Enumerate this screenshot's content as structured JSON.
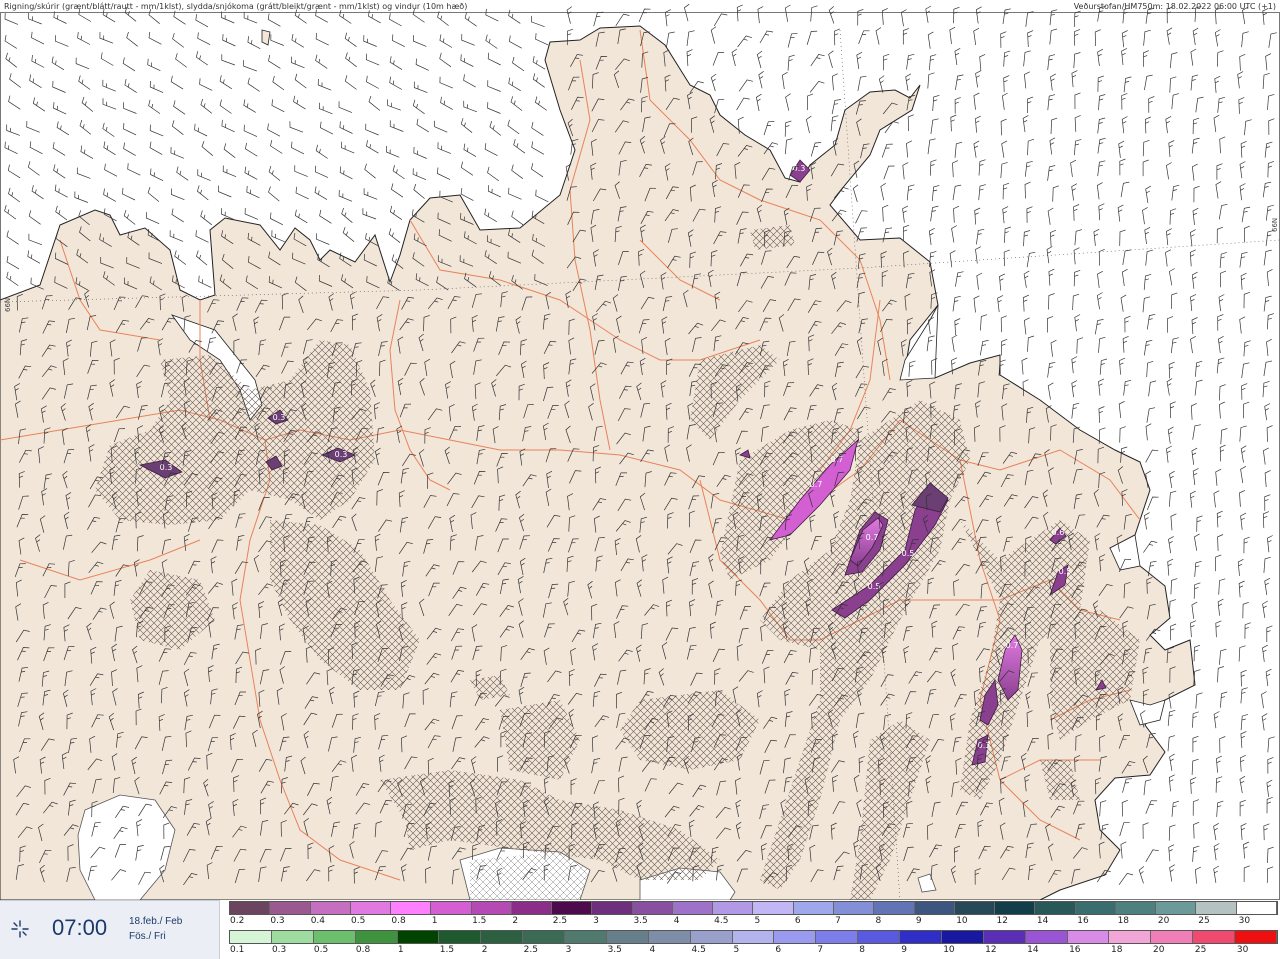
{
  "header": {
    "left": "Rigning/skúrir (grænt/blátt/rautt - mm/1klst), slydda/snjókoma (grátt/bleikt/grænt - mm/1klst) og vindur (10m hæð)",
    "right": "Veðurstofan/HM750m: 18.02.2022 06:00 UTC (+1)"
  },
  "grid_labels": {
    "left": "66N",
    "right": "66N"
  },
  "time": {
    "clock": "07:00",
    "date_line1": "18.feb./ Feb",
    "date_line2": "Fös./ Fri"
  },
  "map_labels": [
    "0.3",
    "0.3",
    "0.3",
    "0.3",
    "0.7",
    "0.7",
    "0.7",
    "0.5",
    "0.5",
    "0.7",
    "0.5",
    "0.6",
    "0.3"
  ],
  "legend": {
    "snow": {
      "labels": [
        "0.2",
        "0.3",
        "0.4",
        "0.5",
        "0.8",
        "1",
        "1.5",
        "2",
        "2.5",
        "3",
        "3.5",
        "4",
        "4.5",
        "5",
        "6",
        "7",
        "8",
        "9",
        "10",
        "12",
        "14",
        "16",
        "18",
        "20",
        "25",
        "30"
      ],
      "colors": [
        "#6b4560",
        "#9a5a8f",
        "#c46fc0",
        "#e07ae0",
        "#ff80ff",
        "#d35fd3",
        "#b54ab5",
        "#8a2e8a",
        "#4d0a4d",
        "#6e2f7d",
        "#8850a0",
        "#9e72c8",
        "#b199e6",
        "#c3b6f5",
        "#9fa8ea",
        "#8390d8",
        "#6273b6",
        "#3d5680",
        "#274858",
        "#123e4a",
        "#285858",
        "#3a6d6d",
        "#4e8080",
        "#6c9a9a",
        "#b4c2c2",
        "#ffffff"
      ]
    },
    "rain": {
      "labels": [
        "0.1",
        "0.3",
        "0.5",
        "0.8",
        "1",
        "1.5",
        "2",
        "2.5",
        "3",
        "3.5",
        "4",
        "4.5",
        "5",
        "6",
        "7",
        "8",
        "9",
        "10",
        "12",
        "14",
        "16",
        "18",
        "20",
        "25",
        "30"
      ],
      "colors": [
        "#d6f5d6",
        "#9fdc9f",
        "#6cbf6c",
        "#3f933f",
        "#004400",
        "#1f5a2f",
        "#2c6040",
        "#3b6b55",
        "#4f7a6d",
        "#667f8a",
        "#7f8ea8",
        "#9aa0cc",
        "#b3b3ee",
        "#9a9af0",
        "#7d7deb",
        "#5a5ae0",
        "#2f2fc8",
        "#1818a0",
        "#5a2fb5",
        "#9a55d5",
        "#d98be8",
        "#f2a6d8",
        "#f07fb8",
        "#f04a70",
        "#ee1010"
      ]
    }
  }
}
